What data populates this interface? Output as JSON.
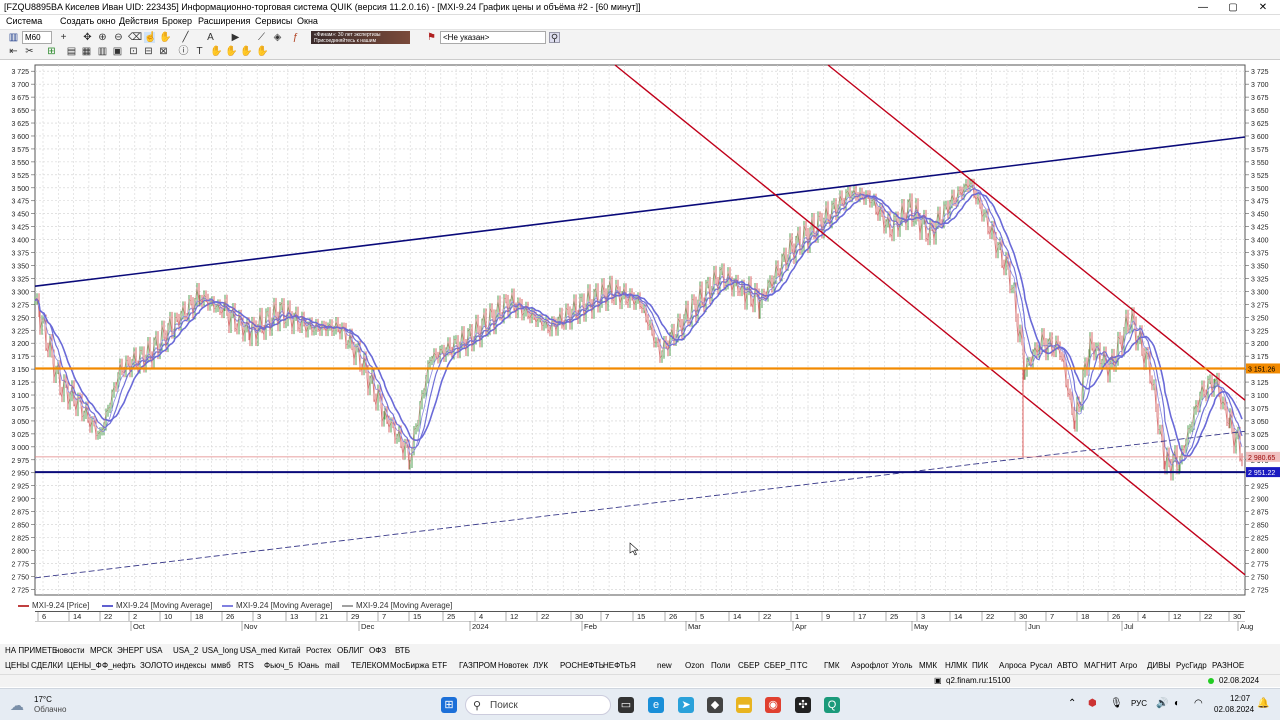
{
  "window": {
    "title": "[FZQU8895BA Киселев Иван UID: 223435] Информационно-торговая система QUIK (версия 11.2.0.16) - [MXI-9.24 График цены и объёма #2 - [60 минут]]",
    "minimize": "—",
    "maximize": "▢",
    "close": "✕"
  },
  "menu": [
    "Система",
    "Создать окно",
    "Действия",
    "Брокер",
    "Расширения",
    "Сервисы",
    "Окна"
  ],
  "toolbar": {
    "interval": "M60",
    "banner": "«Финам»: 30 лет экспертизы Присоединяйтесь к нашим специалистам",
    "account_select": "<Не указан>"
  },
  "chart": {
    "y_ticks": [
      "3 725",
      "3 700",
      "3 675",
      "3 650",
      "3 625",
      "3 600",
      "3 575",
      "3 550",
      "3 525",
      "3 500",
      "3 475",
      "3 450",
      "3 425",
      "3 400",
      "3 375",
      "3 350",
      "3 325",
      "3 300",
      "3 275",
      "3 250",
      "3 225",
      "3 200",
      "3 175",
      "3 150",
      "3 125",
      "3 100",
      "3 075",
      "3 050",
      "3 025",
      "3 000",
      "2 975",
      "2 950",
      "2 925",
      "2 900",
      "2 875",
      "2 850",
      "2 825",
      "2 800",
      "2 775",
      "2 750",
      "2 725"
    ],
    "price_labels": {
      "level_orange": "3 151.26",
      "level_current": "2 980.65",
      "level_blue": "2 951.22"
    },
    "colors": {
      "orange": "#f28a00",
      "navy": "#0a0a7a",
      "channel": "#c0001a",
      "ma": "#6a6ad8",
      "candle_up": "#2a8a2a",
      "candle_down": "#d04040"
    }
  },
  "legend": [
    {
      "label": "MXI-9.24 [Price]",
      "color": "#c04040"
    },
    {
      "label": "MXI-9.24 [Moving Average]",
      "color": "#6060d0"
    },
    {
      "label": "MXI-9.24 [Moving Average]",
      "color": "#8080e0"
    },
    {
      "label": "MXI-9.24 [Moving Average]",
      "color": "#a0a0a0"
    }
  ],
  "x_days": [
    "6",
    "14",
    "22",
    "2",
    "10",
    "18",
    "26",
    "3",
    "13",
    "21",
    "29",
    "7",
    "15",
    "25",
    "4",
    "12",
    "22",
    "30",
    "7",
    "15",
    "26",
    "5",
    "14",
    "22",
    "1",
    "9",
    "17",
    "25",
    "3",
    "14",
    "22",
    "30",
    "7",
    "18",
    "26",
    "4",
    "12",
    "22",
    "30"
  ],
  "x_months": [
    "Oct",
    "Nov",
    "Dec",
    "2024",
    "Feb",
    "Mar",
    "Apr",
    "May",
    "Jun",
    "Jul",
    "Aug"
  ],
  "tabs1": [
    "НА ПРИМЕТЕ",
    "новости",
    "МРСК",
    "ЭНЕРГ",
    "USA",
    "USA_2",
    "USA_long",
    "USA_med",
    "Китай",
    "Ростех",
    "ОБЛИГ",
    "ОФЗ",
    "ВТБ"
  ],
  "tabs2": [
    "ЦЕНЫ",
    "СДЕЛКИ",
    "ЦЕНЫ_Ф",
    "Ф_нефть",
    "ЗОЛОТО",
    "индексы",
    "ммвб",
    "RTS",
    "Фьюч_5",
    "Юань",
    "mail",
    "ТЕЛЕКОМ",
    "МосБиржа",
    "ETF",
    "ГАЗПРОМ",
    "Новотек",
    "ЛУК",
    "РОСНЕФТЬ",
    "НЕФТЬ",
    "Я",
    "new",
    "Ozon",
    "Поли",
    "СБЕР",
    "СБЕР_П",
    "ТС",
    "ГМК",
    "Аэрофлот",
    "Уголь",
    "ММК",
    "НЛМК",
    "ПИК",
    "Алроса",
    "Русал",
    "АВТО",
    "МАГНИТ",
    "Агро",
    "ДИВЫ",
    "РусГидр",
    "РАЗНОЕ"
  ],
  "status": {
    "server": "q2.finam.ru:15100",
    "date": "02.08.2024"
  },
  "taskbar": {
    "weather_temp": "17°C",
    "weather_desc": "Облачно",
    "search": "Поиск",
    "lang": "РУС",
    "time": "12:07",
    "date": "02.08.2024"
  }
}
